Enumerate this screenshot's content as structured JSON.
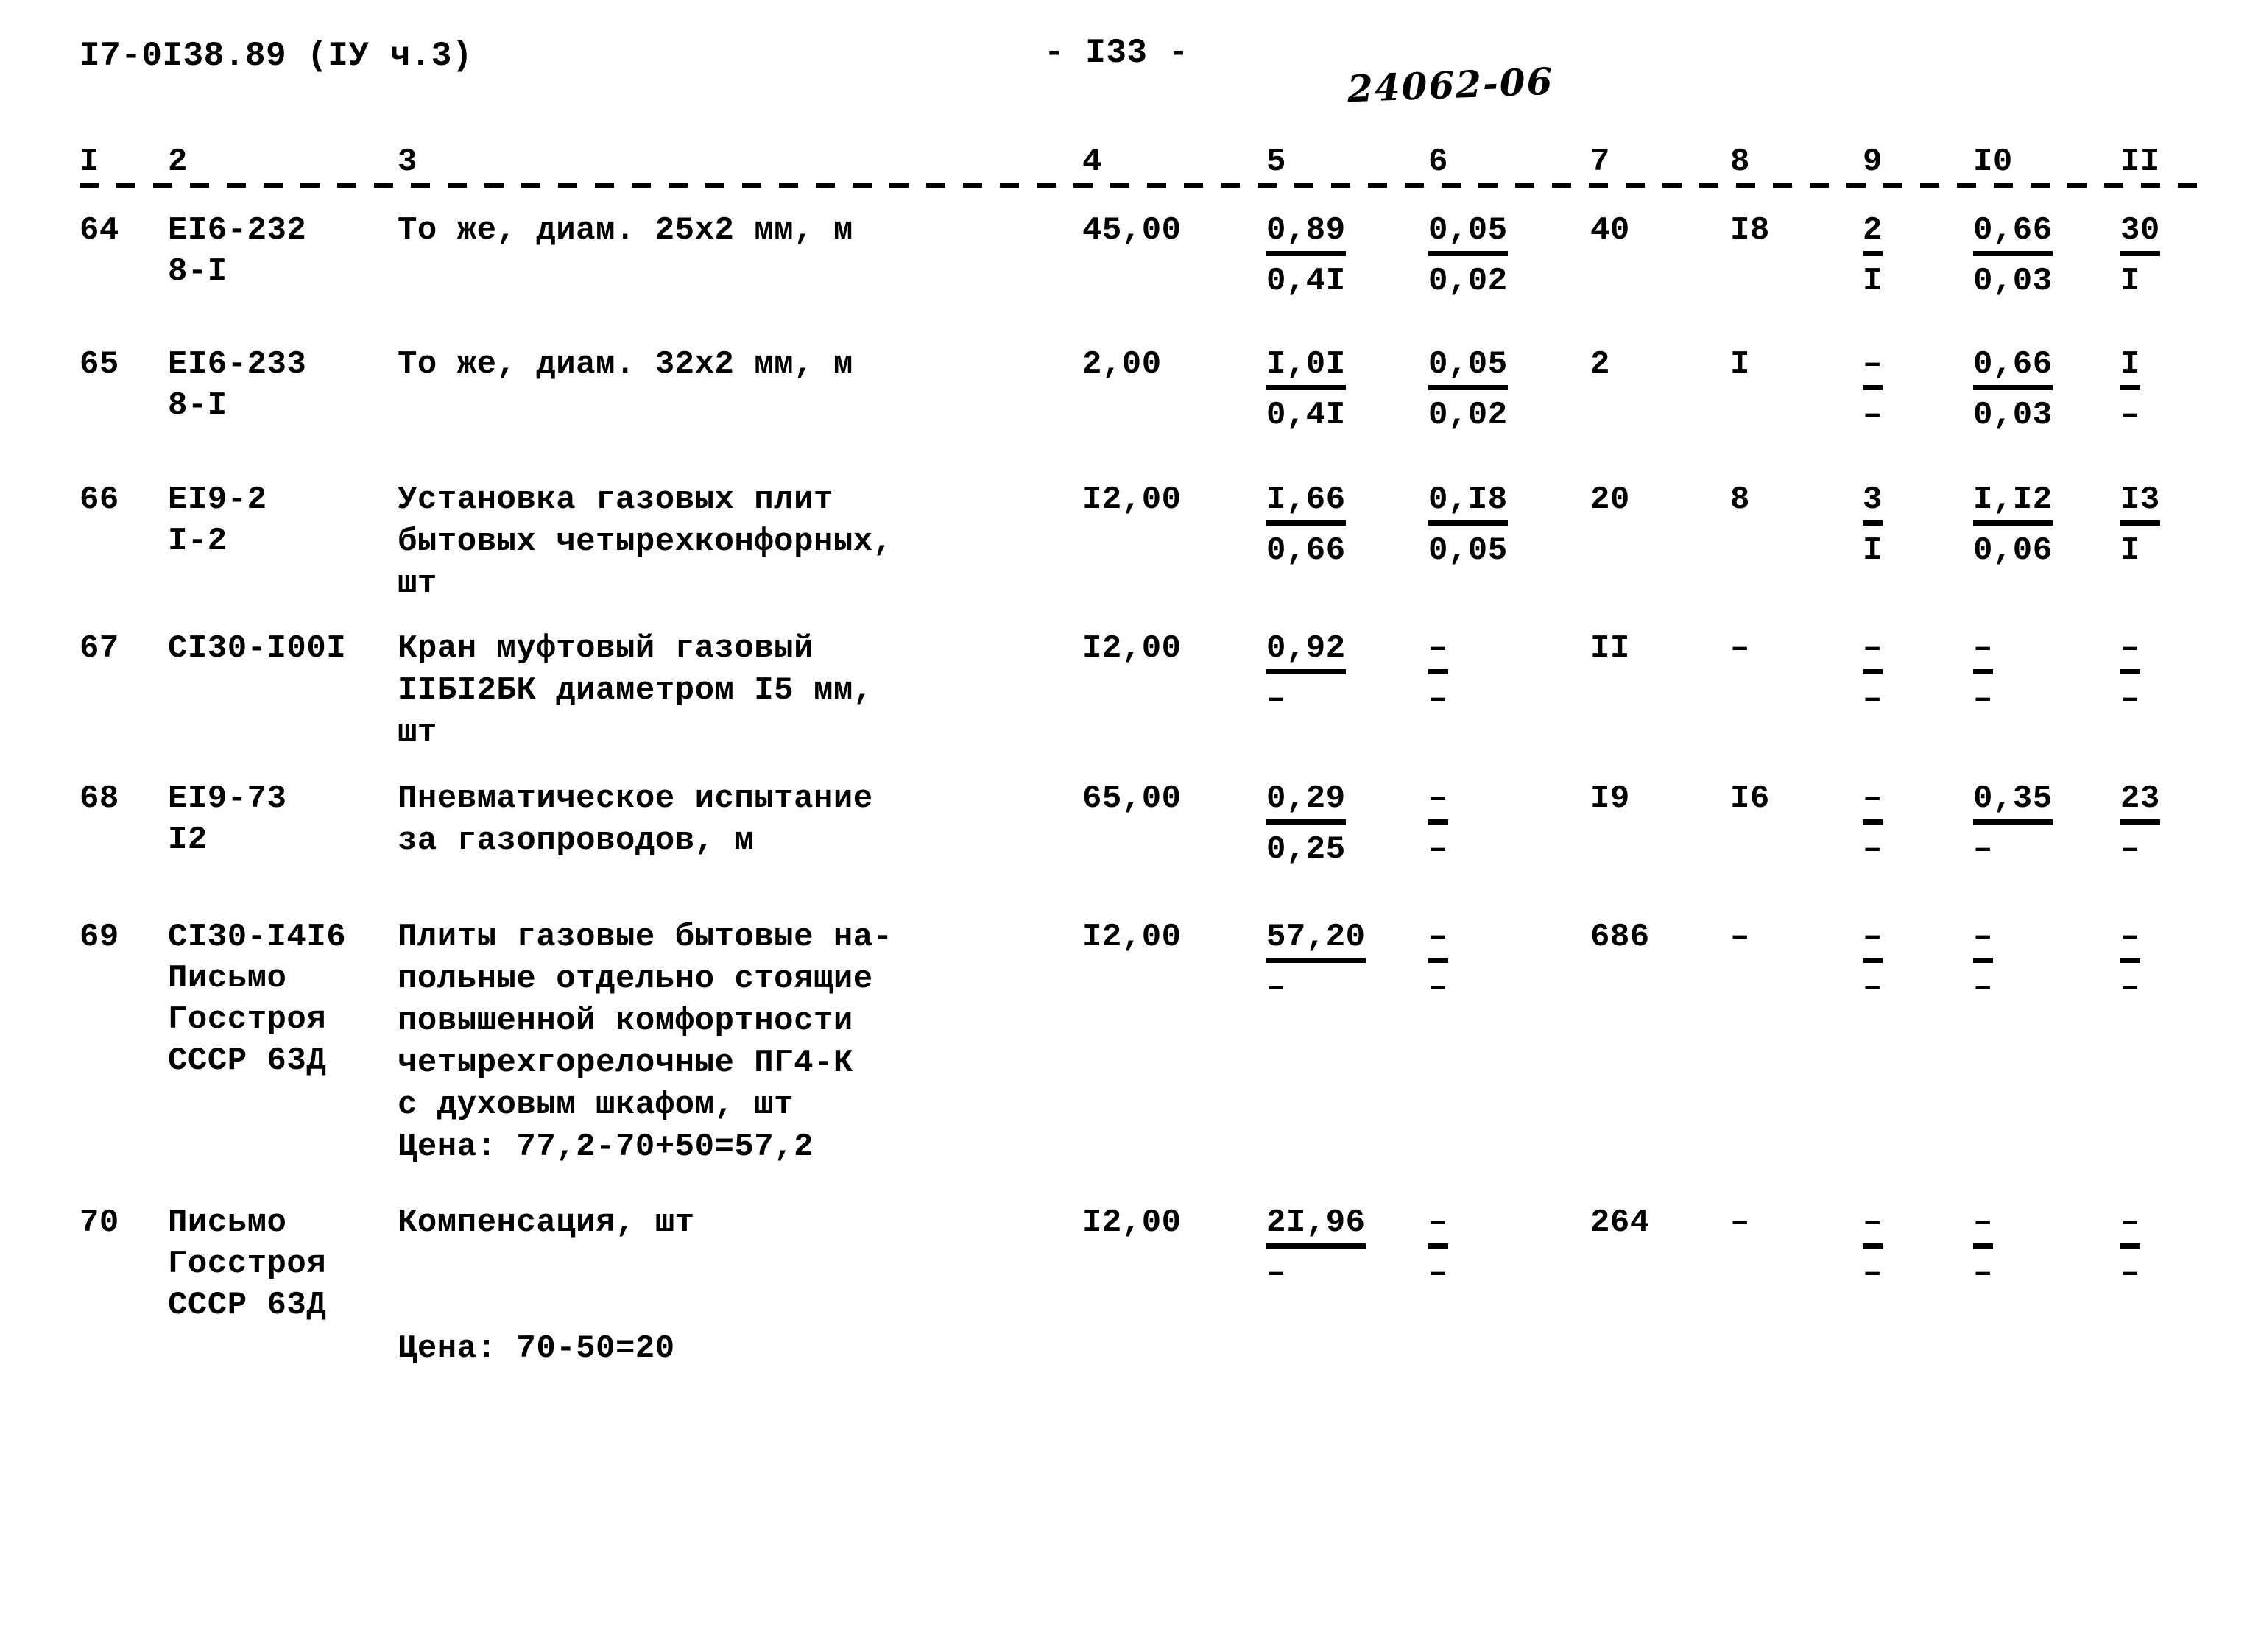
{
  "header": {
    "doc_code": "I7-0I38.89 (IУ ч.3)",
    "page_number": "- I33 -",
    "stamp": "24062-06"
  },
  "columns": [
    "I",
    "2",
    "3",
    "4",
    "5",
    "6",
    "7",
    "8",
    "9",
    "I0",
    "II"
  ],
  "rows": [
    {
      "no": "64",
      "code": "ЕI6-232\n8-I",
      "description": "То же, диам. 25х2 мм, м",
      "c4": "45,00",
      "c5_top": "0,89",
      "c5_bot": "0,4I",
      "c6_top": "0,05",
      "c6_bot": "0,02",
      "c7": "40",
      "c8": "I8",
      "c9_top": "2",
      "c9_bot": "I",
      "c10_top": "0,66",
      "c10_bot": "0,03",
      "c11_top": "30",
      "c11_bot": "I"
    },
    {
      "no": "65",
      "code": "ЕI6-233\n8-I",
      "description": "То же, диам. 32х2 мм, м",
      "c4": "2,00",
      "c5_top": "I,0I",
      "c5_bot": "0,4I",
      "c6_top": "0,05",
      "c6_bot": "0,02",
      "c7": "2",
      "c8": "I",
      "c9_top": "–",
      "c9_bot": "–",
      "c10_top": "0,66",
      "c10_bot": "0,03",
      "c11_top": "I",
      "c11_bot": "–"
    },
    {
      "no": "66",
      "code": "ЕI9-2\nI-2",
      "description": "Установка газовых плит\nбытовых четырехконфорных,\nшт",
      "c4": "I2,00",
      "c5_top": "I,66",
      "c5_bot": "0,66",
      "c6_top": "0,I8",
      "c6_bot": "0,05",
      "c7": "20",
      "c8": "8",
      "c9_top": "3",
      "c9_bot": "I",
      "c10_top": "I,I2",
      "c10_bot": "0,06",
      "c11_top": "I3",
      "c11_bot": "I"
    },
    {
      "no": "67",
      "code": "СI30-I00I",
      "description": "Кран муфтовый газовый\nIIБI2БК диаметром I5 мм,\nшт",
      "c4": "I2,00",
      "c5_top": "0,92",
      "c5_bot": "–",
      "c6_top": "–",
      "c6_bot": "–",
      "c7": "II",
      "c8": "–",
      "c9_top": "–",
      "c9_bot": "–",
      "c10_top": "–",
      "c10_bot": "–",
      "c11_top": "–",
      "c11_bot": "–"
    },
    {
      "no": "68",
      "code": "ЕI9-73\nI2",
      "description": "Пневматическое испытание\nза газопроводов, м",
      "c4": "65,00",
      "c5_top": "0,29",
      "c5_bot": "0,25",
      "c6_top": "–",
      "c6_bot": "–",
      "c7": "I9",
      "c8": "I6",
      "c9_top": "–",
      "c9_bot": "–",
      "c10_top": "0,35",
      "c10_bot": "–",
      "c11_top": "23",
      "c11_bot": "–"
    },
    {
      "no": "69",
      "code": "СI30-I4I6\nПисьмо\nГосстроя\nСССР 63Д",
      "description": "Плиты газовые бытовые на-\nпольные отдельно стоящие\nповышенной комфортности\nчетырехгорелочные ПГ4-К\nс духовым шкафом, шт\nЦена: 77,2-70+50=57,2",
      "c4": "I2,00",
      "c5_top": "57,20",
      "c5_bot": "–",
      "c6_top": "–",
      "c6_bot": "–",
      "c7": "686",
      "c8": "–",
      "c9_top": "–",
      "c9_bot": "–",
      "c10_top": "–",
      "c10_bot": "–",
      "c11_top": "–",
      "c11_bot": "–"
    },
    {
      "no": "70",
      "code": "Письмо\nГосстроя\nСССР 63Д",
      "description": "Компенсация, шт\n\n\nЦена: 70-50=20",
      "c4": "I2,00",
      "c5_top": "2I,96",
      "c5_bot": "–",
      "c6_top": "–",
      "c6_bot": "–",
      "c7": "264",
      "c8": "–",
      "c9_top": "–",
      "c9_bot": "–",
      "c10_top": "–",
      "c10_bot": "–",
      "c11_top": "–",
      "c11_bot": "–"
    }
  ]
}
